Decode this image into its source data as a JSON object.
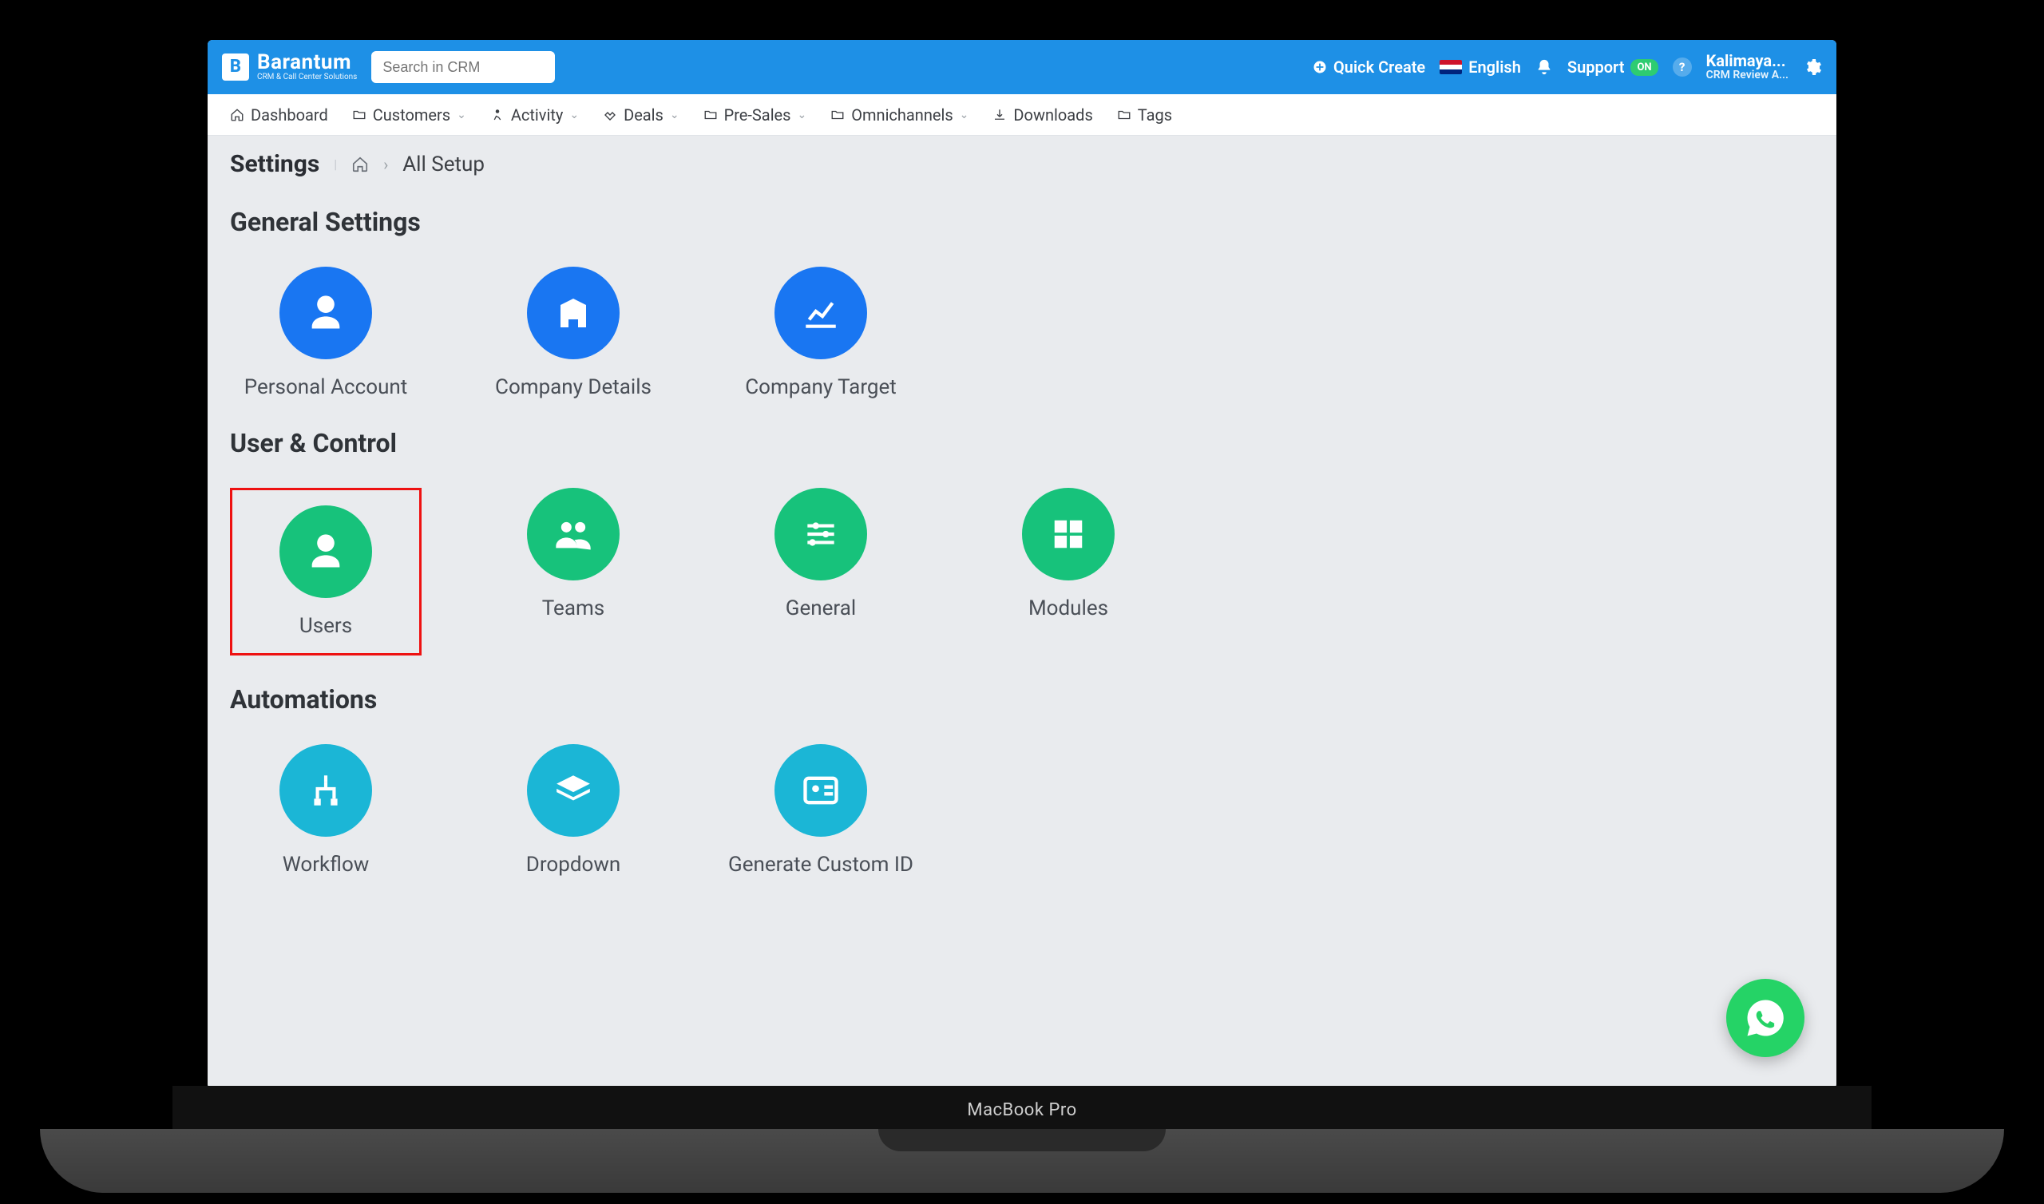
{
  "brand": {
    "name": "Barantum",
    "tagline": "CRM & Call Center Solutions"
  },
  "search": {
    "placeholder": "Search in CRM"
  },
  "quick_create": "Quick Create",
  "language": "English",
  "support_label": "Support",
  "support_badge": "ON",
  "user": {
    "name": "Kalimaya...",
    "sub": "CRM Review A..."
  },
  "nav": {
    "dashboard": "Dashboard",
    "customers": "Customers",
    "activity": "Activity",
    "deals": "Deals",
    "presales": "Pre-Sales",
    "omni": "Omnichannels",
    "downloads": "Downloads",
    "tags": "Tags"
  },
  "page_title": "Settings",
  "breadcrumb_current": "All Setup",
  "sections": {
    "general": "General Settings",
    "user_control": "User & Control",
    "automations": "Automations"
  },
  "tiles": {
    "personal_account": "Personal Account",
    "company_details": "Company Details",
    "company_target": "Company Target",
    "users": "Users",
    "teams": "Teams",
    "general": "General",
    "modules": "Modules",
    "workflow": "Workflow",
    "dropdown": "Dropdown",
    "generate_id": "Generate Custom ID"
  },
  "laptop_label": "MacBook Pro"
}
